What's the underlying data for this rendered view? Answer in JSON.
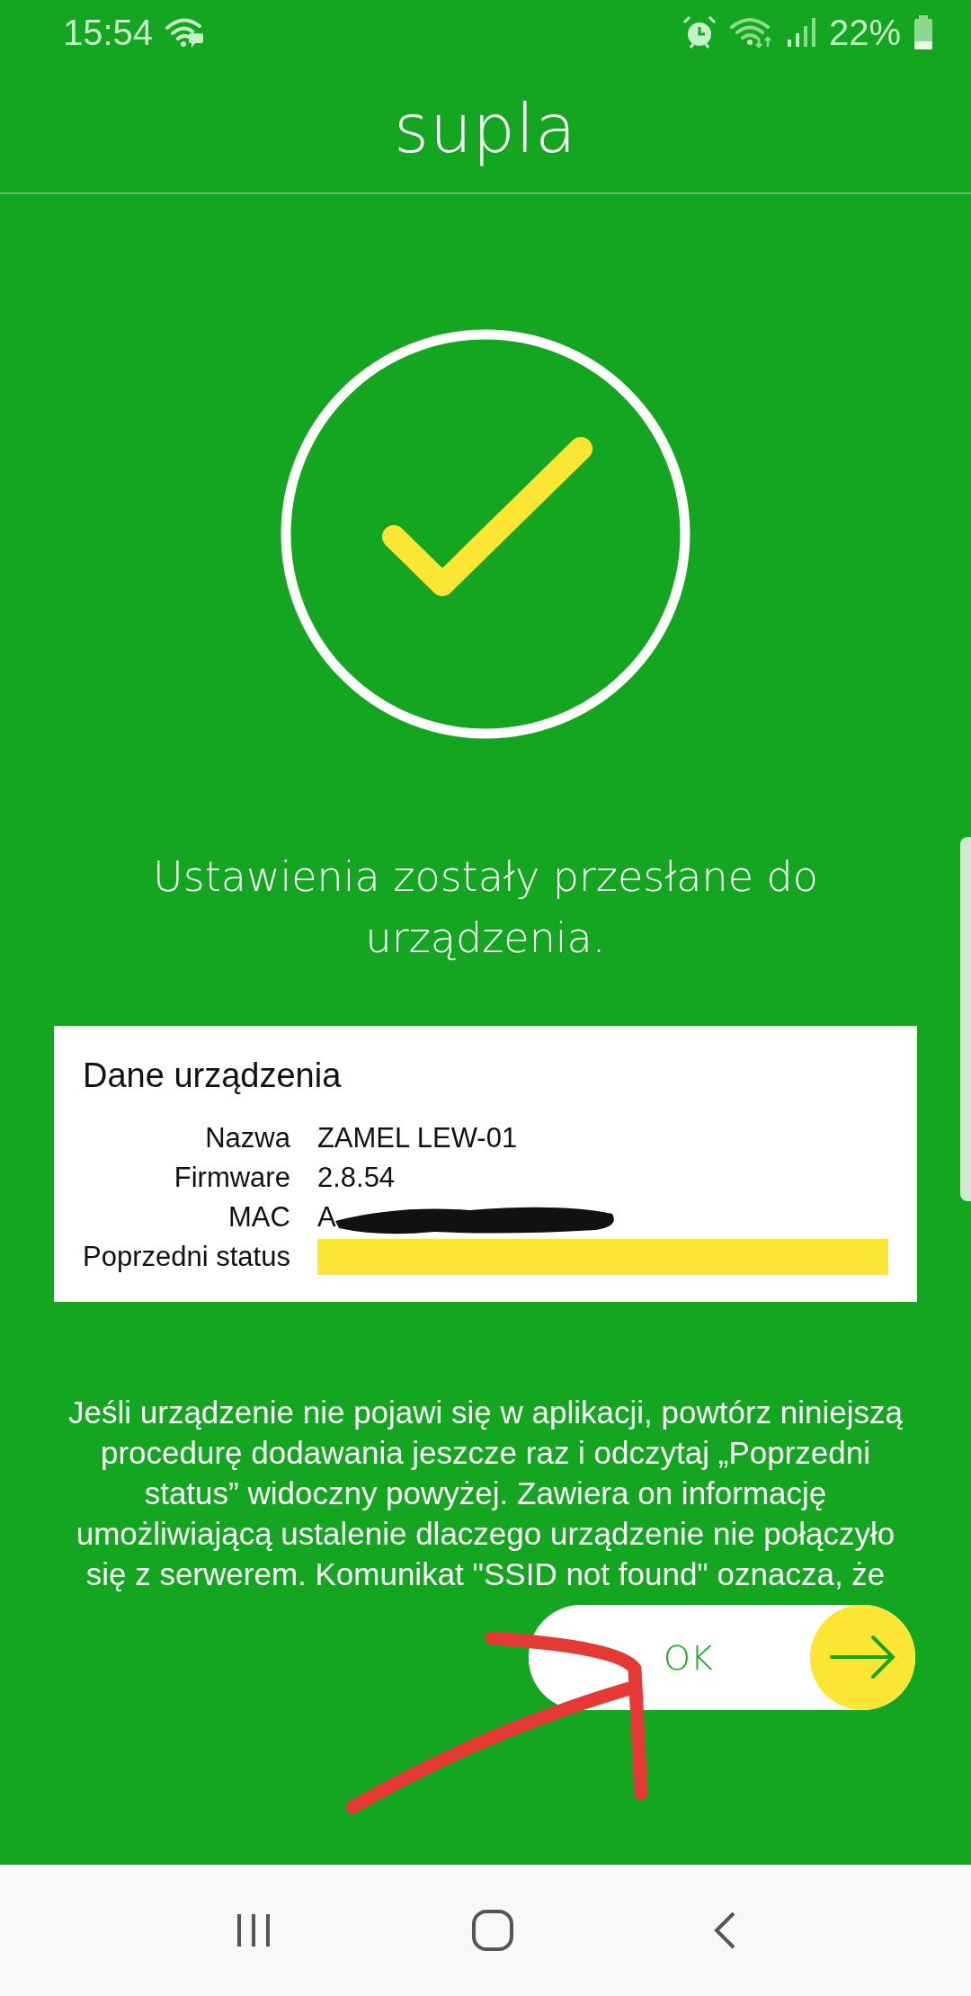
{
  "status_bar": {
    "time": "15:54",
    "battery": "22%"
  },
  "header": {
    "title": "supla"
  },
  "message": "Ustawienia zostały przesłane do urządzenia.",
  "device_card": {
    "title": "Dane urządzenia",
    "rows": [
      {
        "label": "Nazwa",
        "value": "ZAMEL LEW-01",
        "kind": "plain"
      },
      {
        "label": "Firmware",
        "value": "2.8.54",
        "kind": "plain"
      },
      {
        "label": "MAC",
        "value": "A",
        "kind": "scribbled"
      },
      {
        "label": "Poprzedni status",
        "kind": "highlighted"
      }
    ]
  },
  "hint": "Jeśli urządzenie nie pojawi się w aplikacji, powtórz niniejszą procedurę dodawania jeszcze raz i odczytaj „Poprzedni status” widoczny powyżej. Zawiera on informację umożliwiającą ustalenie dlaczego urządzenie nie połączyło się z serwerem. Komunikat \"SSID not found\" oznacza, że",
  "ok_button": {
    "label": "OK"
  }
}
